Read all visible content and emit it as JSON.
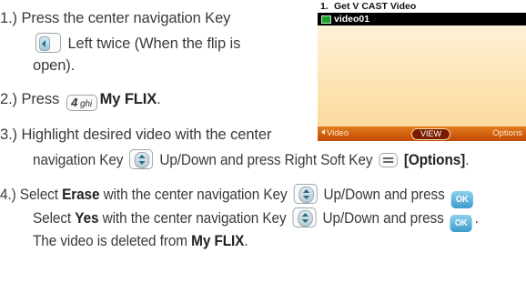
{
  "steps": {
    "s1": {
      "a": "1.) Press the center navigation Key",
      "b": "Left twice (When the flip is",
      "c": "open)."
    },
    "s2": {
      "a": "2.) Press",
      "key_num": "4",
      "key_letters": "ghi",
      "bold": "My FLIX",
      "end": "."
    },
    "s3": {
      "a": "3.) Highlight desired video with the center",
      "b": "navigation Key",
      "c": "Up/Down and press Right Soft Key",
      "bold": "[Options]",
      "end": "."
    },
    "s4": {
      "a": "4.) Select",
      "bold1": "Erase",
      "b": "with the center navigation Key",
      "c": "Up/Down and press",
      "d": "Select",
      "bold2": "Yes",
      "e": "with the center navigation Key",
      "f": "Up/Down and press",
      "g": "The video is deleted from",
      "bold3": "My FLIX",
      "end": "."
    },
    "ok_label": "OK"
  },
  "screen": {
    "row1_num": "1.",
    "row1_text": "Get V CAST Video",
    "row2_text": "video01",
    "softkeys": {
      "left": "Video",
      "center": "VIEW",
      "right": "Options"
    },
    "colors": {
      "softbar": "#c24a00",
      "selected_row": "#000000",
      "background": "#fde4b4"
    }
  }
}
